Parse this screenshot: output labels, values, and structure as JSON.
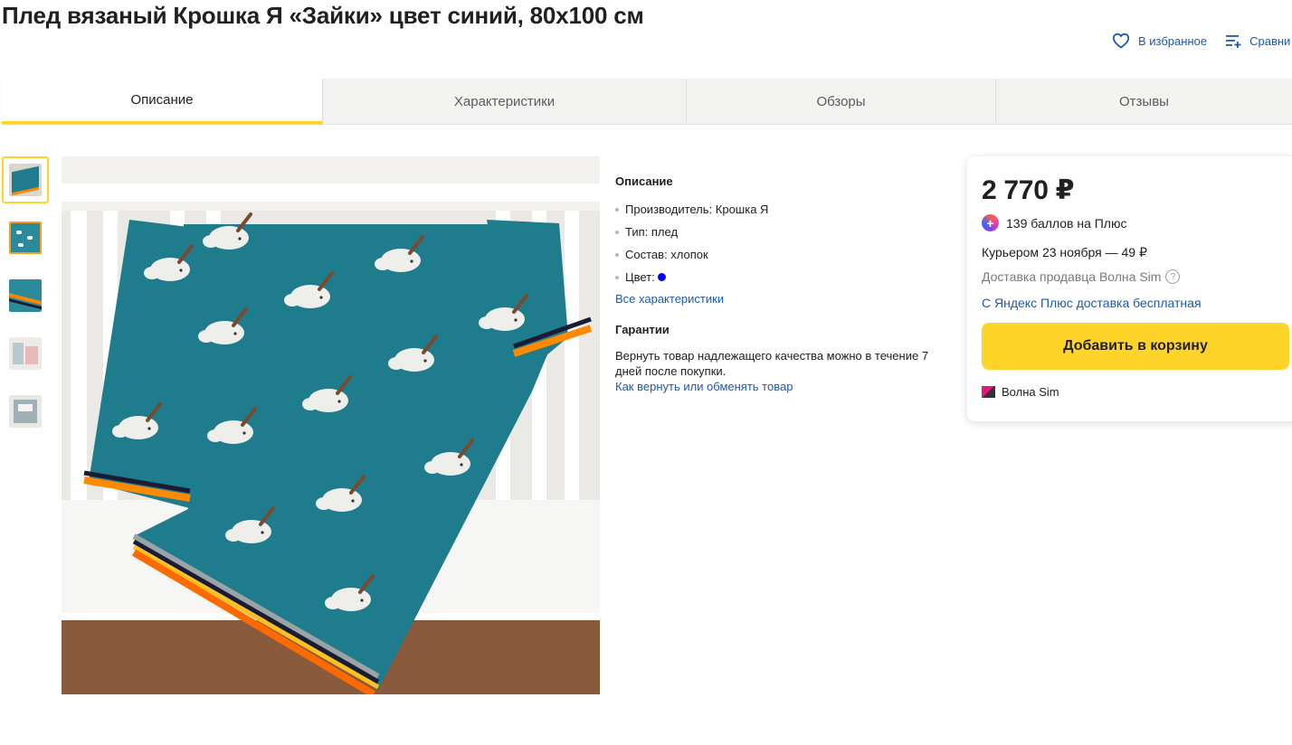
{
  "product": {
    "title": "Плед вязаный Крошка Я «Зайки» цвет синий, 80х100 см"
  },
  "actions": {
    "favorite_label": "В избранное",
    "compare_label": "Сравни"
  },
  "tabs": [
    {
      "label": "Описание",
      "active": true
    },
    {
      "label": "Характеристики",
      "active": false
    },
    {
      "label": "Обзоры",
      "active": false
    },
    {
      "label": "Отзывы",
      "active": false
    }
  ],
  "gallery": {
    "thumbnail_count": 5,
    "selected_index": 0
  },
  "description": {
    "heading": "Описание",
    "specs": [
      "Производитель: Крошка Я",
      "Тип: плед",
      "Состав: хлопок",
      "Цвет:"
    ],
    "color_swatch": "#0000ff",
    "all_specs_link": "Все характеристики",
    "guarantee_heading": "Гарантии",
    "guarantee_text": "Вернуть товар надлежащего качества можно в течение 7 дней после покупки.",
    "return_link": "Как вернуть или обменять товар"
  },
  "offer": {
    "price": "2 770 ₽",
    "plus_points": "139 баллов на Плюс",
    "courier": "Курьером 23 ноября — 49 ₽",
    "seller_delivery": "Доставка продавца Волна Sim",
    "plus_free_delivery": "С Яндекс Плюс доставка бесплатная",
    "add_to_cart": "Добавить в корзину",
    "shop_name": "Волна Sim"
  },
  "colors": {
    "accent": "#fed42b",
    "link": "#1c59b3",
    "blanket": "#1f7c8c"
  }
}
